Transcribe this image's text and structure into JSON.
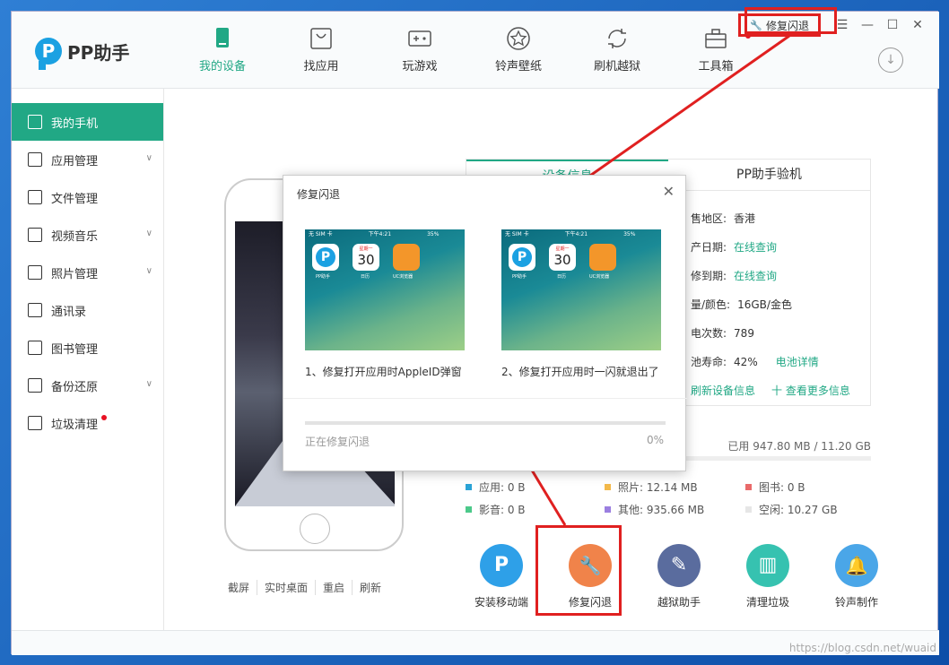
{
  "app": {
    "logo_text": "PP助手",
    "logo_letter": "P"
  },
  "nav": [
    {
      "label": "我的设备",
      "icon": "phone-icon",
      "active": true
    },
    {
      "label": "找应用",
      "icon": "bag-icon"
    },
    {
      "label": "玩游戏",
      "icon": "gamepad-icon"
    },
    {
      "label": "铃声壁纸",
      "icon": "star-icon"
    },
    {
      "label": "刷机越狱",
      "icon": "refresh-icon"
    },
    {
      "label": "工具箱",
      "icon": "toolbox-icon"
    }
  ],
  "window_controls": {
    "fix_label": "修复闪退",
    "menu": "☰",
    "minimize": "—",
    "maximize": "☐",
    "close": "✕"
  },
  "sidebar": [
    {
      "label": "我的手机",
      "active": true
    },
    {
      "label": "应用管理",
      "chevron": true
    },
    {
      "label": "文件管理"
    },
    {
      "label": "视频音乐",
      "chevron": true
    },
    {
      "label": "照片管理",
      "chevron": true
    },
    {
      "label": "通讯录"
    },
    {
      "label": "图书管理"
    },
    {
      "label": "备份还原",
      "chevron": true
    },
    {
      "label": "垃圾清理",
      "dot": true
    }
  ],
  "phone_ops": [
    "截屏",
    "实时桌面",
    "重启",
    "刷新"
  ],
  "info_tabs": [
    "设备信息",
    "PP助手验机"
  ],
  "device_info": {
    "region_label": "售地区:",
    "region_value": "香港",
    "prod_label": "产日期:",
    "prod_value": "在线查询",
    "warranty_label": "修到期:",
    "warranty_value": "在线查询",
    "cap_label": "量/颜色:",
    "cap_value": "16GB/金色",
    "charge_label": "电次数:",
    "charge_value": "789",
    "battery_label": "池寿命:",
    "battery_value": "42%",
    "battery_link": "电池详情",
    "refresh_link": "刷新设备信息",
    "more_link": "十 查看更多信息"
  },
  "storage": {
    "used": "已用 947.80 MB / 11.20 GB"
  },
  "legend": [
    {
      "label": "应用: 0 B",
      "color": "#2aa3d6"
    },
    {
      "label": "照片: 12.14 MB",
      "color": "#f3b94a"
    },
    {
      "label": "图书: 0 B",
      "color": "#e96a6a"
    },
    {
      "label": "影音: 0 B",
      "color": "#4cc98a"
    },
    {
      "label": "其他: 935.66 MB",
      "color": "#9b7fe0"
    },
    {
      "label": "空闲: 10.27 GB",
      "color": "#e6e6e6"
    }
  ],
  "tools": [
    {
      "label": "安装移动端",
      "color": "#2ea0e8",
      "glyph": "P"
    },
    {
      "label": "修复闪退",
      "color": "#f0834a",
      "glyph": "🔧"
    },
    {
      "label": "越狱助手",
      "color": "#5a6c9e",
      "glyph": "✎"
    },
    {
      "label": "清理垃圾",
      "color": "#36c2b0",
      "glyph": "▥"
    },
    {
      "label": "铃声制作",
      "color": "#4aa6e8",
      "glyph": "🔔"
    }
  ],
  "dialog": {
    "title": "修复闪退",
    "close": "✕",
    "shot_status": "无 SIM 卡",
    "shot_time": "下午4:21",
    "shot_battery": "35%",
    "app1": "PP助手",
    "app2": "日历",
    "app2_num": "30",
    "app2_top": "星期一",
    "app3": "UC浏览器",
    "cap1": "1、修复打开应用时AppleID弹窗",
    "cap2": "2、修复打开应用时一闪就退出了",
    "status": "正在修复闪退",
    "percent": "0%",
    "progress": 0
  },
  "watermark": "https://blog.csdn.net/wuaid"
}
